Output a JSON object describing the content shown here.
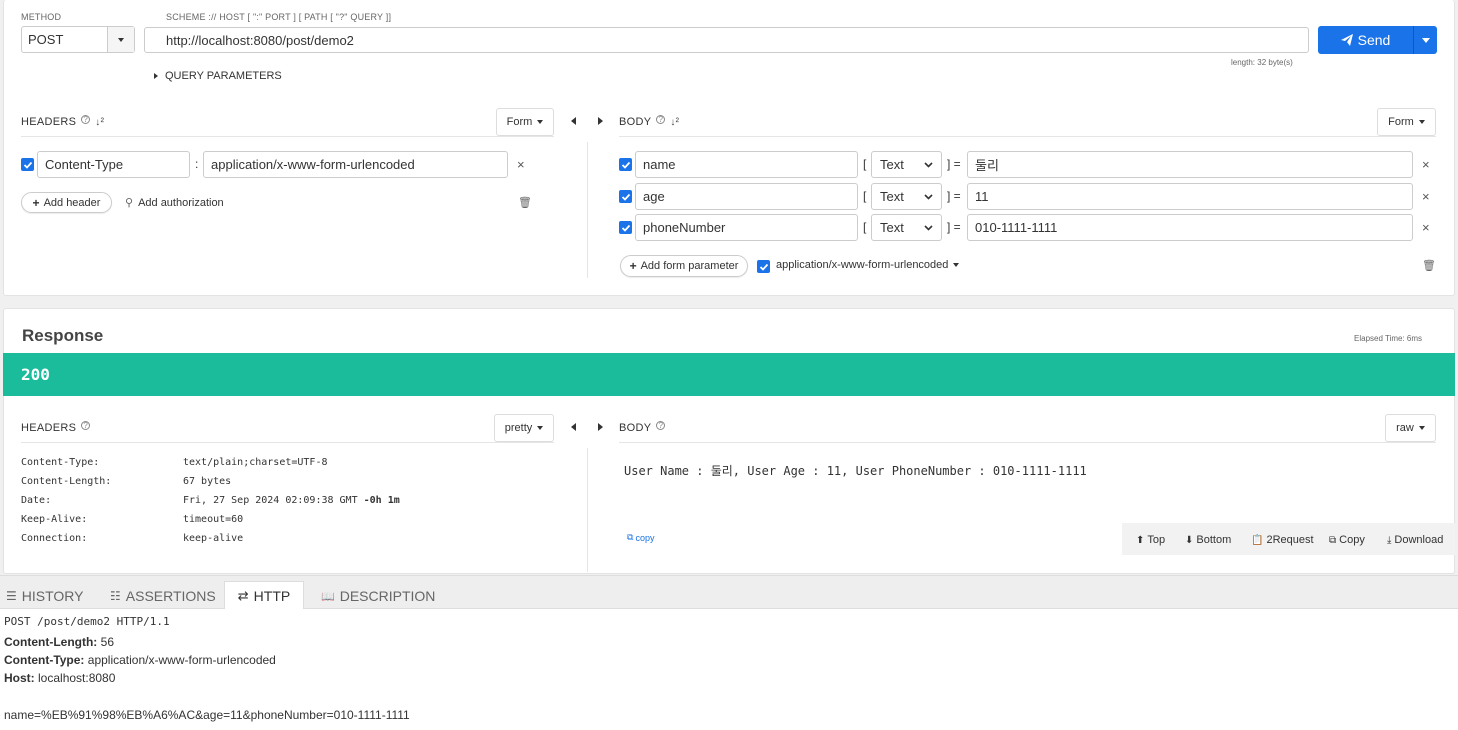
{
  "request": {
    "method_label": "METHOD",
    "method": "POST",
    "url_label": "SCHEME :// HOST [ \":\" PORT ] [ PATH [ \"?\" QUERY ]]",
    "url": "http://localhost:8080/post/demo2",
    "length_info": "length: 32 byte(s)",
    "send_label": "Send",
    "query_params_label": "QUERY PARAMETERS"
  },
  "req_headers": {
    "title": "HEADERS",
    "mode": "Form",
    "rows": [
      {
        "name": "Content-Type",
        "value": "application/x-www-form-urlencoded",
        "checked": true
      }
    ],
    "add_header_label": "Add header",
    "add_auth_label": "Add authorization"
  },
  "req_body": {
    "title": "BODY",
    "mode": "Form",
    "rows": [
      {
        "name": "name",
        "type": "Text",
        "value": "둘리",
        "checked": true
      },
      {
        "name": "age",
        "type": "Text",
        "value": "11",
        "checked": true
      },
      {
        "name": "phoneNumber",
        "type": "Text",
        "value": "010-1111-1111",
        "checked": true
      }
    ],
    "add_param_label": "Add form parameter",
    "content_type": "application/x-www-form-urlencoded"
  },
  "response": {
    "title": "Response",
    "elapsed": "Elapsed Time: 6ms",
    "status": "200",
    "status_color": "#1abc9c",
    "headers_title": "HEADERS",
    "headers_mode": "pretty",
    "headers": [
      {
        "key": "Content-Type:",
        "value": "text/plain;charset=UTF-8",
        "extra": ""
      },
      {
        "key": "Content-Length:",
        "value": "67 bytes",
        "extra": ""
      },
      {
        "key": "Date:",
        "value": "Fri, 27 Sep 2024 02:09:38 GMT ",
        "extra": "-0h 1m"
      },
      {
        "key": "Keep-Alive:",
        "value": "timeout=60",
        "extra": ""
      },
      {
        "key": "Connection:",
        "value": "keep-alive",
        "extra": ""
      }
    ],
    "body_title": "BODY",
    "body_mode": "raw",
    "body_text": "User Name : 둘리, User Age : 11, User PhoneNumber : 010-1111-1111",
    "copy_label": "copy",
    "tools": [
      "Top",
      "Bottom",
      "2Request",
      "Copy",
      "Download"
    ]
  },
  "bottom_tabs": [
    {
      "label": "HISTORY",
      "icon": "list-icon",
      "active": false
    },
    {
      "label": "ASSERTIONS",
      "icon": "checklist-icon",
      "active": false
    },
    {
      "label": "HTTP",
      "icon": "swap-icon",
      "active": true
    },
    {
      "label": "DESCRIPTION",
      "icon": "book-icon",
      "active": false
    }
  ],
  "http_raw": {
    "request_line": "POST /post/demo2 HTTP/1.1",
    "headers": [
      {
        "key": "Content-Length:",
        "value": "56"
      },
      {
        "key": "Content-Type:",
        "value": "application/x-www-form-urlencoded"
      },
      {
        "key": "Host:",
        "value": "localhost:8080"
      }
    ],
    "body": "name=%EB%91%98%EB%A6%AC&age=11&phoneNumber=010-1111-1111"
  },
  "colors": {
    "primary": "#1a73e8",
    "status_ok": "#1abc9c"
  }
}
